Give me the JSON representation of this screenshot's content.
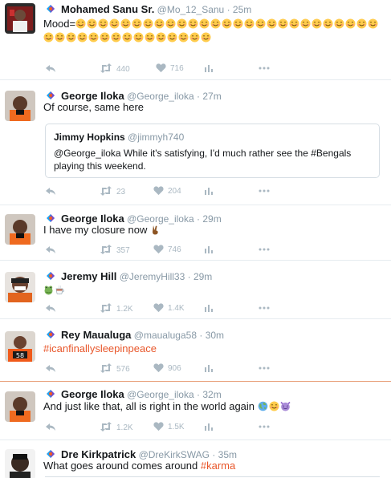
{
  "tweets": [
    {
      "name": "Mohamed Sanu Sr.",
      "handle": "@Mo_12_Sanu",
      "time": "25m",
      "text_prefix": "Mood=",
      "emoji_count": 42,
      "retweets": "440",
      "likes": "716",
      "avatar_icon": "avatar-photo"
    },
    {
      "name": "George Iloka",
      "handle": "@George_iloka",
      "time": "27m",
      "text": "Of course, same here",
      "quote": {
        "name": "Jimmy Hopkins",
        "handle": "@jimmyh740",
        "text": "@George_iloka While it's satisfying, I'd much rather see the #Bengals playing this weekend."
      },
      "retweets": "23",
      "likes": "204"
    },
    {
      "name": "George Iloka",
      "handle": "@George_iloka",
      "time": "29m",
      "text": "I have my closure now",
      "retweets": "357",
      "likes": "746"
    },
    {
      "name": "Jeremy Hill",
      "handle": "@JeremyHill33",
      "time": "29m",
      "retweets": "1.2K",
      "likes": "1.4K"
    },
    {
      "name": "Rey Maualuga",
      "handle": "@maualuga58",
      "time": "30m",
      "hashtag": "#icanfinallysleepinpeace",
      "retweets": "576",
      "likes": "906"
    },
    {
      "name": "George Iloka",
      "handle": "@George_iloka",
      "time": "32m",
      "text": "And just like that, all is right in the world again",
      "retweets": "1.2K",
      "likes": "1.5K"
    },
    {
      "name": "Dre Kirkpatrick",
      "handle": "@DreKirkSWAG",
      "time": "35m",
      "text": "What goes around comes around",
      "hashtag": "#karma"
    }
  ],
  "separator": "·",
  "colors": {
    "hashtag": "#e8562a",
    "meta": "#8899a6",
    "action": "#aab8c2",
    "divider": "#e6ecf0"
  }
}
